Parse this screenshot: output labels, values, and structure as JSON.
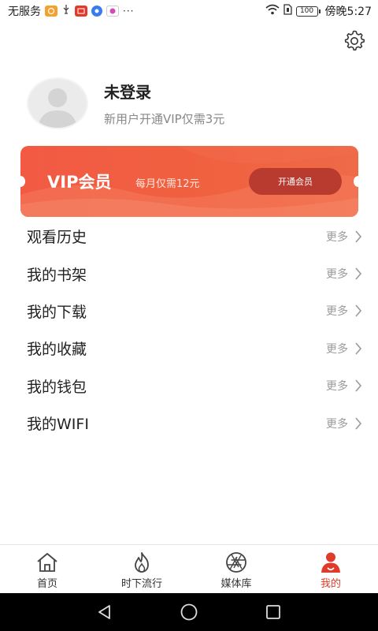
{
  "status_bar": {
    "carrier": "无服务",
    "time_label": "傍晚5:27",
    "battery": "100",
    "dots": "···"
  },
  "profile": {
    "name": "未登录",
    "subtitle": "新用户开通VIP仅需3元"
  },
  "vip": {
    "title": "VIP会员",
    "price_note": "每月仅需12元",
    "button_label": "开通会员"
  },
  "menu": {
    "items": [
      {
        "label": "观看历史",
        "more": "更多"
      },
      {
        "label": "我的书架",
        "more": "更多"
      },
      {
        "label": "我的下载",
        "more": "更多"
      },
      {
        "label": "我的收藏",
        "more": "更多"
      },
      {
        "label": "我的钱包",
        "more": "更多"
      },
      {
        "label": "我的WIFI",
        "more": "更多"
      }
    ]
  },
  "tabbar": {
    "tabs": [
      {
        "label": "首页",
        "icon": "home-icon",
        "active": false
      },
      {
        "label": "时下流行",
        "icon": "flame-icon",
        "active": false
      },
      {
        "label": "媒体库",
        "icon": "aperture-icon",
        "active": false
      },
      {
        "label": "我的",
        "icon": "user-icon",
        "active": true
      }
    ]
  },
  "colors": {
    "accent": "#e03a2a",
    "vip_gradient_start": "#f25a44",
    "vip_gradient_end": "#ef6a47",
    "vip_button": "#b93a2e"
  }
}
